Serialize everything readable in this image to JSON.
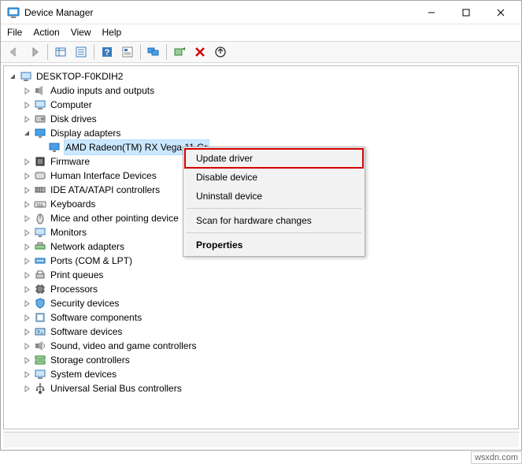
{
  "window": {
    "title": "Device Manager"
  },
  "menus": [
    "File",
    "Action",
    "View",
    "Help"
  ],
  "toolbar_icons": [
    "back",
    "forward",
    "sep",
    "show-hidden",
    "properties",
    "sep",
    "help",
    "details",
    "sep",
    "monitor",
    "sep",
    "scan",
    "delete",
    "update"
  ],
  "root": "DESKTOP-F0KDIH2",
  "categories": [
    {
      "icon": "audio",
      "label": "Audio inputs and outputs",
      "expanded": false
    },
    {
      "icon": "computer",
      "label": "Computer",
      "expanded": false
    },
    {
      "icon": "disk",
      "label": "Disk drives",
      "expanded": false
    },
    {
      "icon": "display",
      "label": "Display adapters",
      "expanded": true,
      "children": [
        {
          "icon": "gpu",
          "label": "AMD Radeon(TM) RX Vega 11 Gr",
          "selected": true
        }
      ]
    },
    {
      "icon": "firmware",
      "label": "Firmware",
      "expanded": false
    },
    {
      "icon": "hid",
      "label": "Human Interface Devices",
      "expanded": false
    },
    {
      "icon": "ide",
      "label": "IDE ATA/ATAPI controllers",
      "expanded": false
    },
    {
      "icon": "keyboard",
      "label": "Keyboards",
      "expanded": false
    },
    {
      "icon": "mouse",
      "label": "Mice and other pointing device",
      "expanded": false
    },
    {
      "icon": "monitor",
      "label": "Monitors",
      "expanded": false
    },
    {
      "icon": "network",
      "label": "Network adapters",
      "expanded": false
    },
    {
      "icon": "port",
      "label": "Ports (COM & LPT)",
      "expanded": false
    },
    {
      "icon": "printq",
      "label": "Print queues",
      "expanded": false
    },
    {
      "icon": "cpu",
      "label": "Processors",
      "expanded": false
    },
    {
      "icon": "security",
      "label": "Security devices",
      "expanded": false
    },
    {
      "icon": "swcomp",
      "label": "Software components",
      "expanded": false
    },
    {
      "icon": "swdev",
      "label": "Software devices",
      "expanded": false
    },
    {
      "icon": "sound",
      "label": "Sound, video and game controllers",
      "expanded": false
    },
    {
      "icon": "storage",
      "label": "Storage controllers",
      "expanded": false
    },
    {
      "icon": "sysdev",
      "label": "System devices",
      "expanded": false
    },
    {
      "icon": "usb",
      "label": "Universal Serial Bus controllers",
      "expanded": false
    }
  ],
  "context_menu": {
    "items": [
      {
        "label": "Update driver",
        "highlight": true
      },
      {
        "label": "Disable device"
      },
      {
        "label": "Uninstall device"
      },
      {
        "sep": true
      },
      {
        "label": "Scan for hardware changes"
      },
      {
        "sep": true
      },
      {
        "label": "Properties",
        "bold": true
      }
    ]
  },
  "watermark": "wsxdn.com"
}
